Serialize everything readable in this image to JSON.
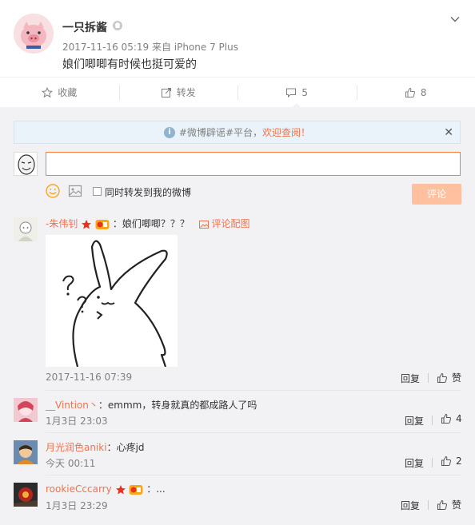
{
  "post": {
    "author": "一只拆酱",
    "timestamp": "2017-11-16 05:19",
    "source": "来自 iPhone 7 Plus",
    "text": "娘们唧唧有时候也挺可爱的"
  },
  "actions": [
    {
      "label": "收藏",
      "icon": "star-icon"
    },
    {
      "label": "转发",
      "icon": "share-icon"
    },
    {
      "label": "5",
      "icon": "comment-icon"
    },
    {
      "label": "8",
      "icon": "thumbs-up-icon"
    }
  ],
  "comment_box": {
    "notice_prefix": "#微博辟谣#平台，",
    "notice_link": "欢迎查阅！",
    "forward_label": "同时转发到我的微博",
    "submit_label": "评论"
  },
  "comments": [
    {
      "name": "-朱伟钊",
      "text": "：娘们唧唧？？？",
      "pic_link": "评论配图",
      "time": "2017-11-16 07:39",
      "reply": "回复",
      "like": "赞"
    },
    {
      "name": "__Vintion丶",
      "text": "：emmm，转身就真的都成路人了吗",
      "time": "1月3日 23:03",
      "reply": "回复",
      "like": "4"
    },
    {
      "name": "月光润色aniki",
      "text": "：心疼jd",
      "time": "今天 00:11",
      "reply": "回复",
      "like": "2"
    },
    {
      "name": "rookieCccarry",
      "text": "：...",
      "time": "1月3日 23:29",
      "reply": "回复",
      "like": "赞"
    }
  ],
  "colors": {
    "accent": "#eb7350",
    "input_border": "#fa7d3c",
    "submit": "#ffc09f",
    "panel_bg": "#f2f2f5"
  }
}
